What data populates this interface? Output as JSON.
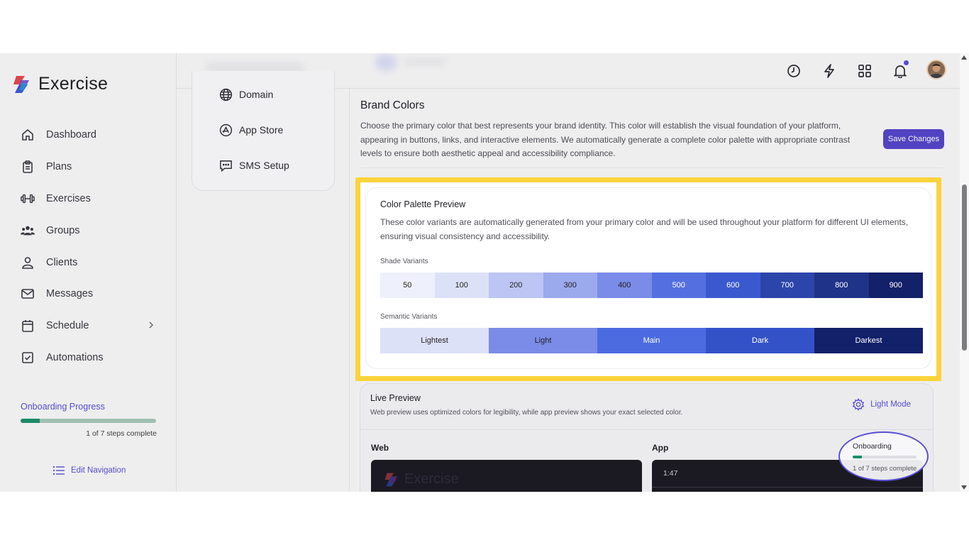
{
  "app": {
    "name": "Exercise"
  },
  "sidebar": {
    "items": [
      {
        "label": "Dashboard",
        "icon": "home-icon"
      },
      {
        "label": "Plans",
        "icon": "clipboard-icon"
      },
      {
        "label": "Exercises",
        "icon": "dumbbell-icon"
      },
      {
        "label": "Groups",
        "icon": "users-icon"
      },
      {
        "label": "Clients",
        "icon": "user-icon"
      },
      {
        "label": "Messages",
        "icon": "mail-icon"
      },
      {
        "label": "Schedule",
        "icon": "calendar-icon",
        "has_submenu": true
      },
      {
        "label": "Automations",
        "icon": "checkbox-icon"
      }
    ],
    "onboarding": {
      "title": "Onboarding Progress",
      "progress": 0.143,
      "status": "1 of 7 steps complete"
    },
    "edit_navigation": "Edit Navigation"
  },
  "topbar": {
    "icons": [
      "clock-icon",
      "lightning-icon",
      "grid-icon",
      "bell-icon"
    ],
    "notification_dot": true
  },
  "settings_nav": {
    "items": [
      {
        "label": "Domain",
        "icon": "globe-icon"
      },
      {
        "label": "App Store",
        "icon": "app-store-icon"
      },
      {
        "label": "SMS Setup",
        "icon": "message-icon"
      }
    ]
  },
  "brand": {
    "title": "Brand Colors",
    "description": "Choose the primary color that best represents your brand identity. This color will establish the visual foundation of your platform, appearing in buttons, links, and interactive elements. We automatically generate a complete color palette with appropriate contrast levels to ensure both aesthetic appeal and accessibility compliance.",
    "save_label": "Save Changes"
  },
  "palette": {
    "title": "Color Palette Preview",
    "description": "These color variants are automatically generated from your primary color and will be used throughout your platform for different UI elements, ensuring visual consistency and accessibility.",
    "shade_label": "Shade Variants",
    "shades": [
      {
        "label": "50",
        "color": "#eef0fb",
        "text": "#222222"
      },
      {
        "label": "100",
        "color": "#dde1f8",
        "text": "#222222"
      },
      {
        "label": "200",
        "color": "#bcc5f3",
        "text": "#222222"
      },
      {
        "label": "300",
        "color": "#9ba9ed",
        "text": "#222222"
      },
      {
        "label": "400",
        "color": "#7a8ce7",
        "text": "#222222"
      },
      {
        "label": "500",
        "color": "#5470e0",
        "text": "#ffffff"
      },
      {
        "label": "600",
        "color": "#3b59cf",
        "text": "#ffffff"
      },
      {
        "label": "700",
        "color": "#2c45ab",
        "text": "#ffffff"
      },
      {
        "label": "800",
        "color": "#1f3388",
        "text": "#ffffff"
      },
      {
        "label": "900",
        "color": "#13206a",
        "text": "#ffffff"
      }
    ],
    "semantic_label": "Semantic Variants",
    "semantic": [
      {
        "label": "Lightest",
        "color": "#dde1f8",
        "text": "#222222"
      },
      {
        "label": "Light",
        "color": "#7a8ce7",
        "text": "#222222"
      },
      {
        "label": "Main",
        "color": "#4c6be0",
        "text": "#ffffff"
      },
      {
        "label": "Dark",
        "color": "#3452c8",
        "text": "#ffffff"
      },
      {
        "label": "Darkest",
        "color": "#13206a",
        "text": "#ffffff"
      }
    ]
  },
  "live_preview": {
    "title": "Live Preview",
    "description": "Web preview uses optimized colors for legibility, while app preview shows your exact selected color.",
    "mode_label": "Light Mode",
    "web_label": "Web",
    "app_label": "App",
    "web_logo": "Exercise",
    "app_time": "1:47"
  },
  "floating_onboarding": {
    "title": "Onboarding",
    "status": "1 of 7 steps complete",
    "progress": 0.143
  },
  "colors": {
    "accent": "#5446c9",
    "highlight": "#fcd33a",
    "progress": "#1d8f6a"
  }
}
